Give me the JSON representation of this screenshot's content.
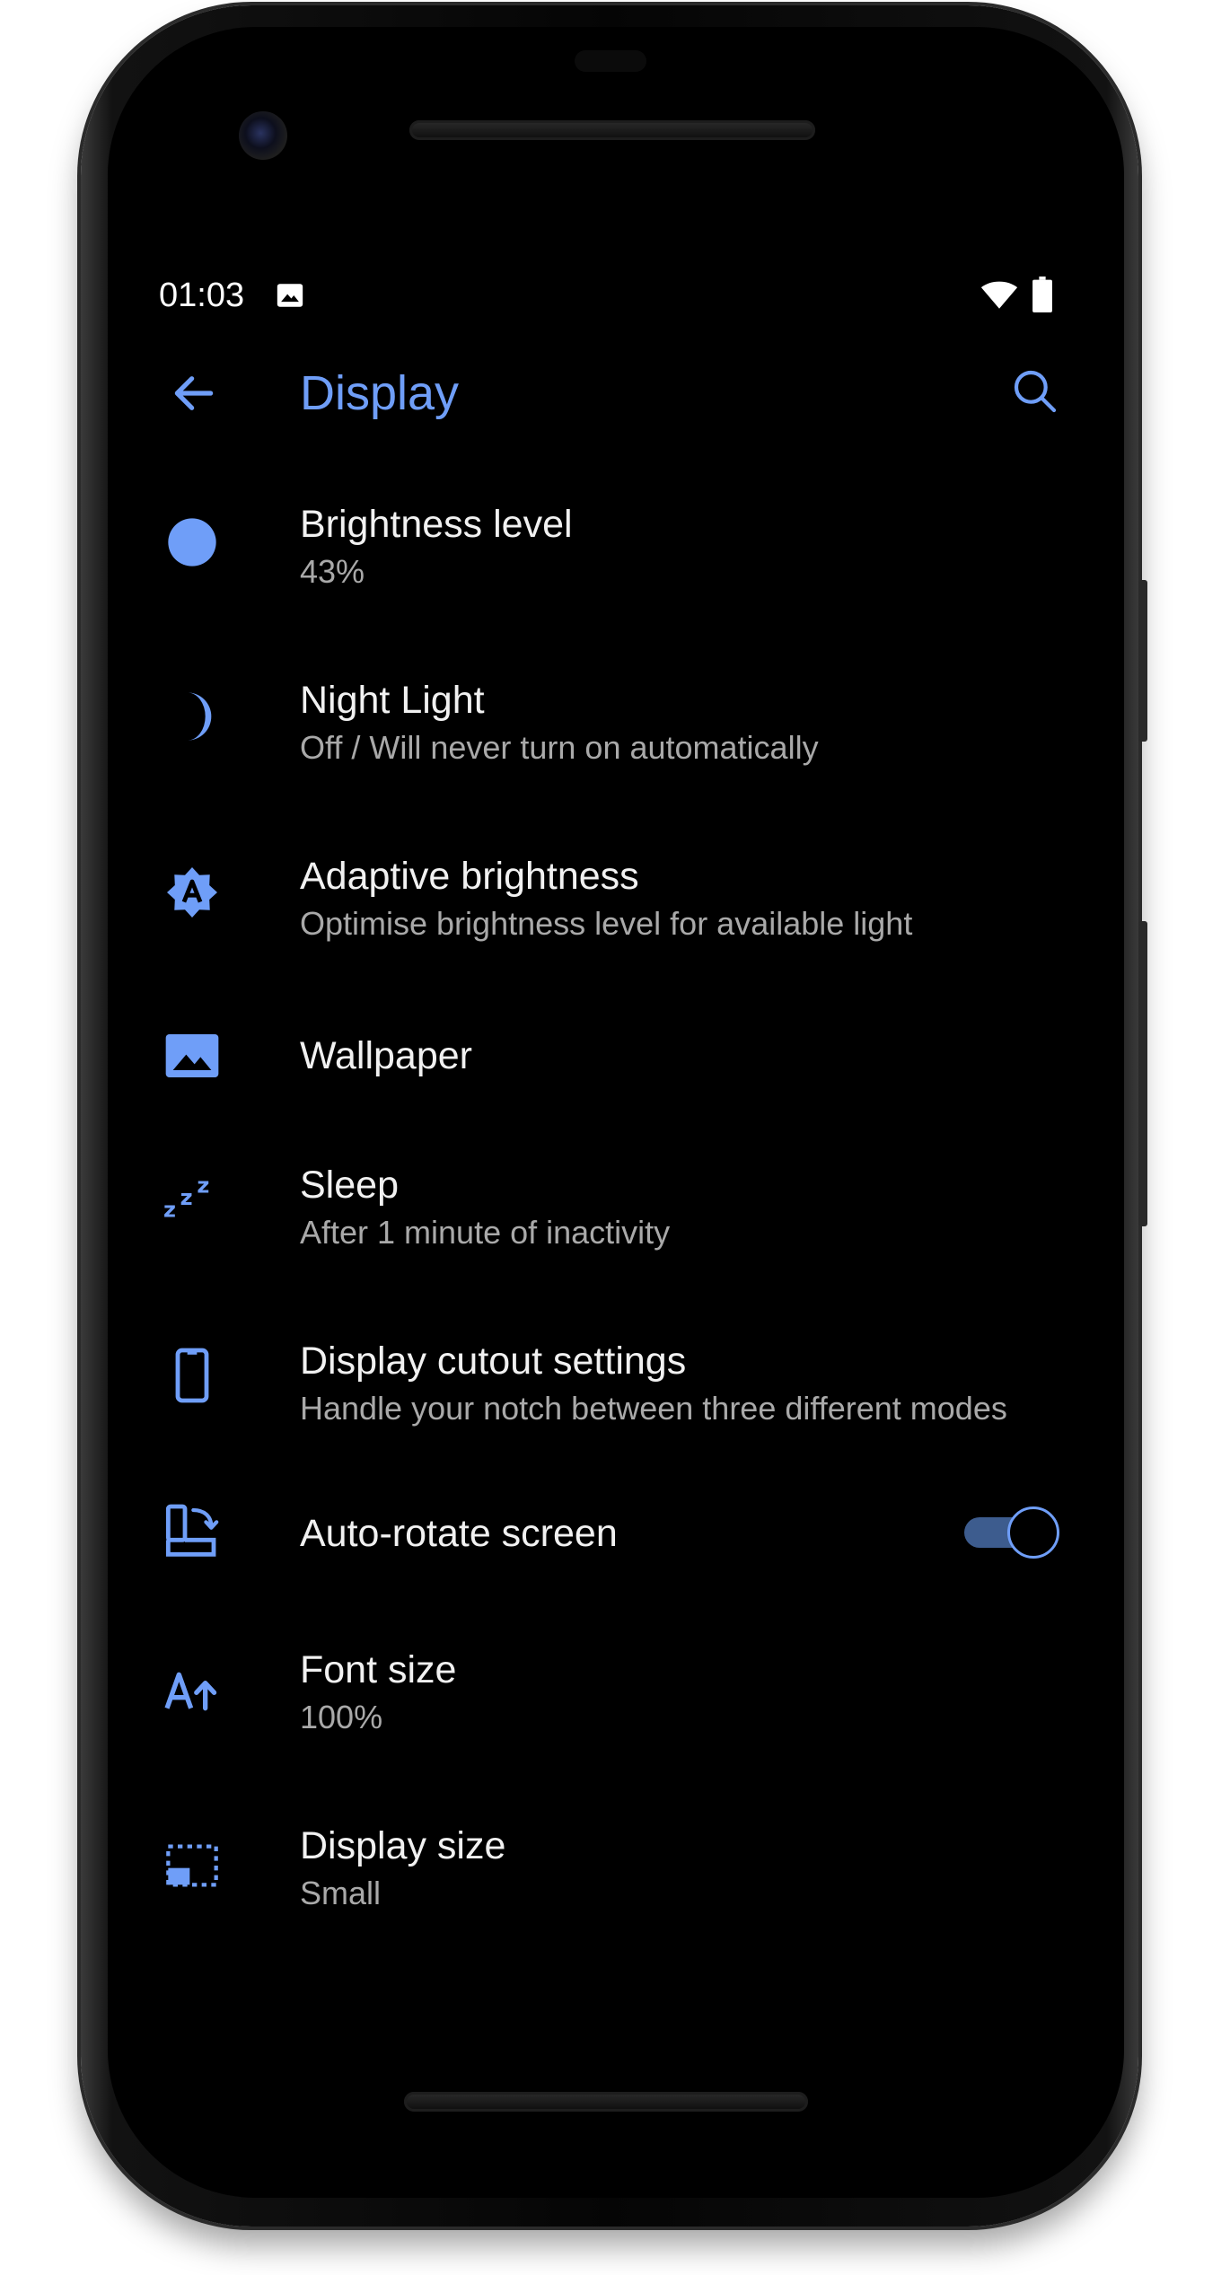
{
  "status_bar": {
    "time": "01:03"
  },
  "app_bar": {
    "title": "Display"
  },
  "settings": [
    {
      "title": "Brightness level",
      "subtitle": "43%",
      "icon": "brightness-icon"
    },
    {
      "title": "Night Light",
      "subtitle": "Off / Will never turn on automatically",
      "icon": "night-light-icon"
    },
    {
      "title": "Adaptive brightness",
      "subtitle": "Optimise brightness level for available light",
      "icon": "adaptive-brightness-icon"
    },
    {
      "title": "Wallpaper",
      "subtitle": "",
      "icon": "wallpaper-icon"
    },
    {
      "title": "Sleep",
      "subtitle": "After 1 minute of inactivity",
      "icon": "sleep-icon"
    },
    {
      "title": "Display cutout settings",
      "subtitle": "Handle your notch between three different modes",
      "icon": "phone-cutout-icon"
    },
    {
      "title": "Auto-rotate screen",
      "subtitle": "",
      "icon": "auto-rotate-icon",
      "toggle_on": true
    },
    {
      "title": "Font size",
      "subtitle": "100%",
      "icon": "font-size-icon"
    },
    {
      "title": "Display size",
      "subtitle": "Small",
      "icon": "display-size-icon"
    }
  ],
  "colors": {
    "accent": "#6f9ef8",
    "background": "#000000",
    "title_text": "#f1f1f1",
    "subtitle_text": "#a9a9a9"
  }
}
